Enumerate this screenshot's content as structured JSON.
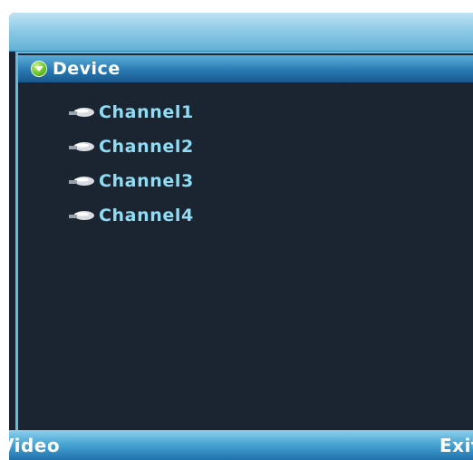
{
  "tree": {
    "root": {
      "label": "Device",
      "icon": "expand-circle-icon",
      "expanded": true
    },
    "channels": [
      {
        "label": "Channel1",
        "icon": "camera-icon"
      },
      {
        "label": "Channel2",
        "icon": "camera-icon"
      },
      {
        "label": "Channel3",
        "icon": "camera-icon"
      },
      {
        "label": "Channel4",
        "icon": "camera-icon"
      }
    ]
  },
  "softkeys": {
    "left": "Video",
    "right": "Exit"
  },
  "colors": {
    "background": "#1b2431",
    "selection": "#2a79b3",
    "channel_text": "#8fdcf5",
    "bar": "#4aa6d4"
  }
}
